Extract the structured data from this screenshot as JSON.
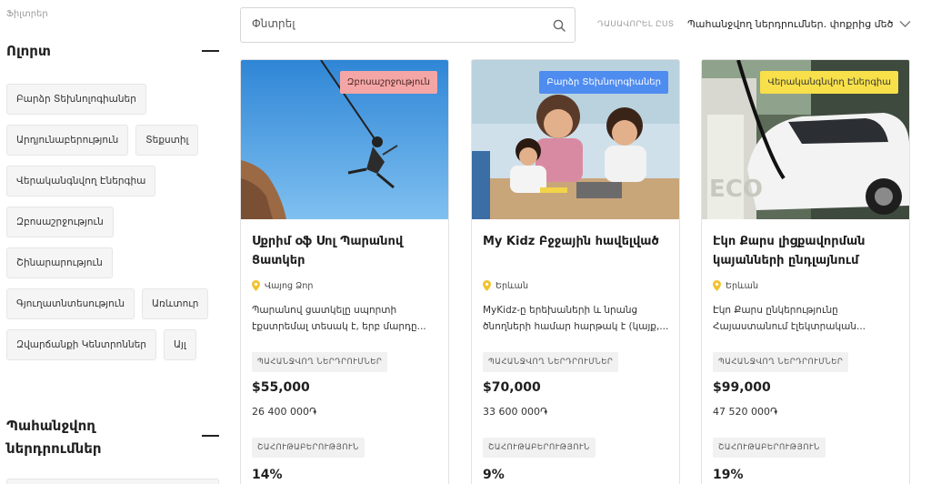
{
  "sidebar": {
    "filters_label": "Ֆիլտրեր",
    "categories_title": "Ոլորտ",
    "categories": [
      "Բարձր Տեխնոլոգիաներ",
      "Արդյունաբերություն",
      "Տեքստիլ",
      "Վերականգնվող Էներգիա",
      "Զբոսաշրջություն",
      "Շինարարություն",
      "Գյուղատնտեսություն",
      "Առևտուր",
      "Զվարճանքի Կենտրոններ",
      "Այլ"
    ],
    "investment_title": "Պահանջվող ներդրումներ"
  },
  "search": {
    "placeholder": "Փնտրել",
    "icon": "search-icon"
  },
  "sort": {
    "label": "ԴԱՍԱՎՈՐԵԼ ԸՍՏ",
    "value": "Պահանջվող ներդրումներ. փոքրից մեծ",
    "icon": "chevron-down-icon"
  },
  "cards": [
    {
      "badge": "Զբոսաշրջություն",
      "badge_color": "#f4a6a6",
      "title": "Սքրիմ օֆ Սոլ Պարանով Ցատկեր",
      "location": "Վայոց Ձոր",
      "description": "Պարանով ցատկելը սպորտի էքստրեմալ տեսակ է, երբ մարդը...",
      "investment_label": "ՊԱՀԱՆՋՎՈՂ ՆԵՐԴՐՈՒՄՆԵՐ",
      "price_usd": "$55,000",
      "price_amd": "26 400 000֏",
      "profit_label": "ՇԱՀՈՒԹԱԲԵՐՈՒԹՅՈՒՆ",
      "profit": "14%"
    },
    {
      "badge": "Բարձր Տեխնոլոգիաներ",
      "badge_color": "#4f8cf0",
      "title": "My Kidz Բջջային հավելված",
      "location": "Երևան",
      "description": "MyKidz-ը երեխաների և նրանց ծնողների համար հարթակ է (կայք,...",
      "investment_label": "ՊԱՀԱՆՋՎՈՂ ՆԵՐԴՐՈՒՄՆԵՐ",
      "price_usd": "$70,000",
      "price_amd": "33 600 000֏",
      "profit_label": "ՇԱՀՈՒԹԱԲԵՐՈՒԹՅՈՒՆ",
      "profit": "9%"
    },
    {
      "badge": "Վերականգնվող Էներգիա",
      "badge_color": "#f7e04a",
      "title": "Էկո Քարս լիցքավորման կայանների ընդլայնում",
      "location": "Երևան",
      "description": "Էկո Քարս ընկերությունը Հայաստանում էլեկտրական...",
      "investment_label": "ՊԱՀԱՆՋՎՈՂ ՆԵՐԴՐՈՒՄՆԵՐ",
      "price_usd": "$99,000",
      "price_amd": "47 520 000֏",
      "profit_label": "ՇԱՀՈՒԹԱԲԵՐՈՒԹՅՈՒՆ",
      "profit": "19%"
    }
  ]
}
